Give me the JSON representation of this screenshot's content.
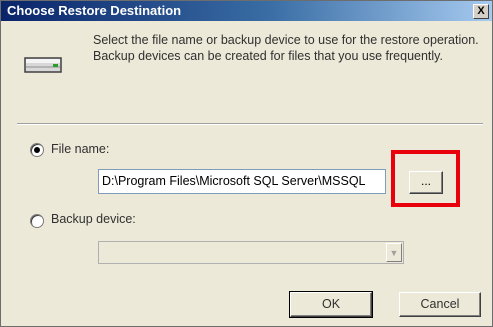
{
  "window": {
    "title": "Choose Restore Destination",
    "close_label": "X"
  },
  "description": "Select the file name or backup device to use for the restore operation.  Backup devices can be created for files that you use frequently.",
  "file_name": {
    "label": "File name:",
    "selected": true,
    "value": "D:\\Program Files\\Microsoft SQL Server\\MSSQL",
    "browse_label": "..."
  },
  "backup_device": {
    "label": "Backup device:",
    "selected": false,
    "value": ""
  },
  "buttons": {
    "ok": "OK",
    "cancel": "Cancel"
  },
  "colors": {
    "highlight": "#e8000b",
    "titlebar": "#0a246a"
  },
  "icons": {
    "device": "backup-device-icon",
    "dropdown": "chevron-down-icon"
  }
}
